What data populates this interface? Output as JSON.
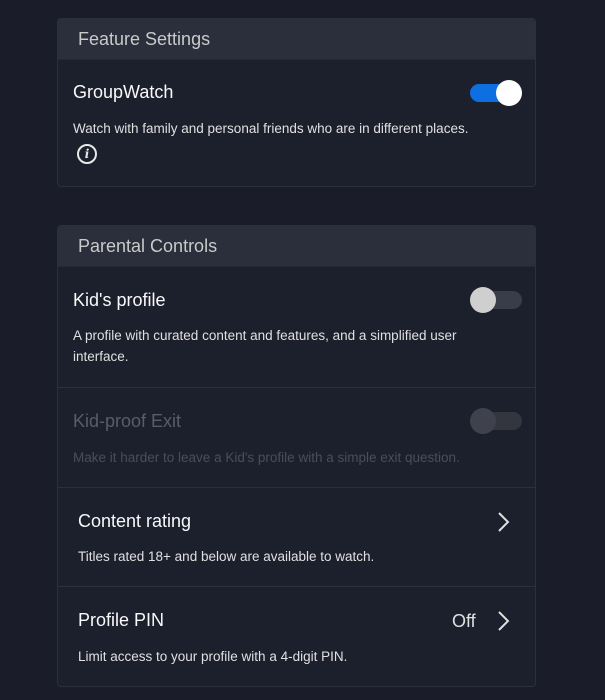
{
  "feature_settings": {
    "header": "Feature Settings",
    "groupwatch": {
      "title": "GroupWatch",
      "description": "Watch with family and personal friends who are in different places.",
      "enabled": true
    }
  },
  "parental_controls": {
    "header": "Parental Controls",
    "kids_profile": {
      "title": "Kid's profile",
      "description_line1": "A profile with curated content and features, and a simplified user",
      "description_line2": "interface.",
      "enabled": false
    },
    "kid_proof_exit": {
      "title": "Kid-proof Exit",
      "description": "Make it harder to leave a Kid's profile with a simple exit question.",
      "enabled": false,
      "disabled": true
    },
    "content_rating": {
      "title": "Content rating",
      "description": "Titles rated 18+ and below are available to watch."
    },
    "profile_pin": {
      "title": "Profile PIN",
      "value": "Off",
      "description": "Limit access to your profile with a 4-digit PIN."
    }
  },
  "colors": {
    "background": "#1a1d29",
    "toggle_on": "#0d6fe0",
    "header_bg": "#2b2e3b"
  }
}
